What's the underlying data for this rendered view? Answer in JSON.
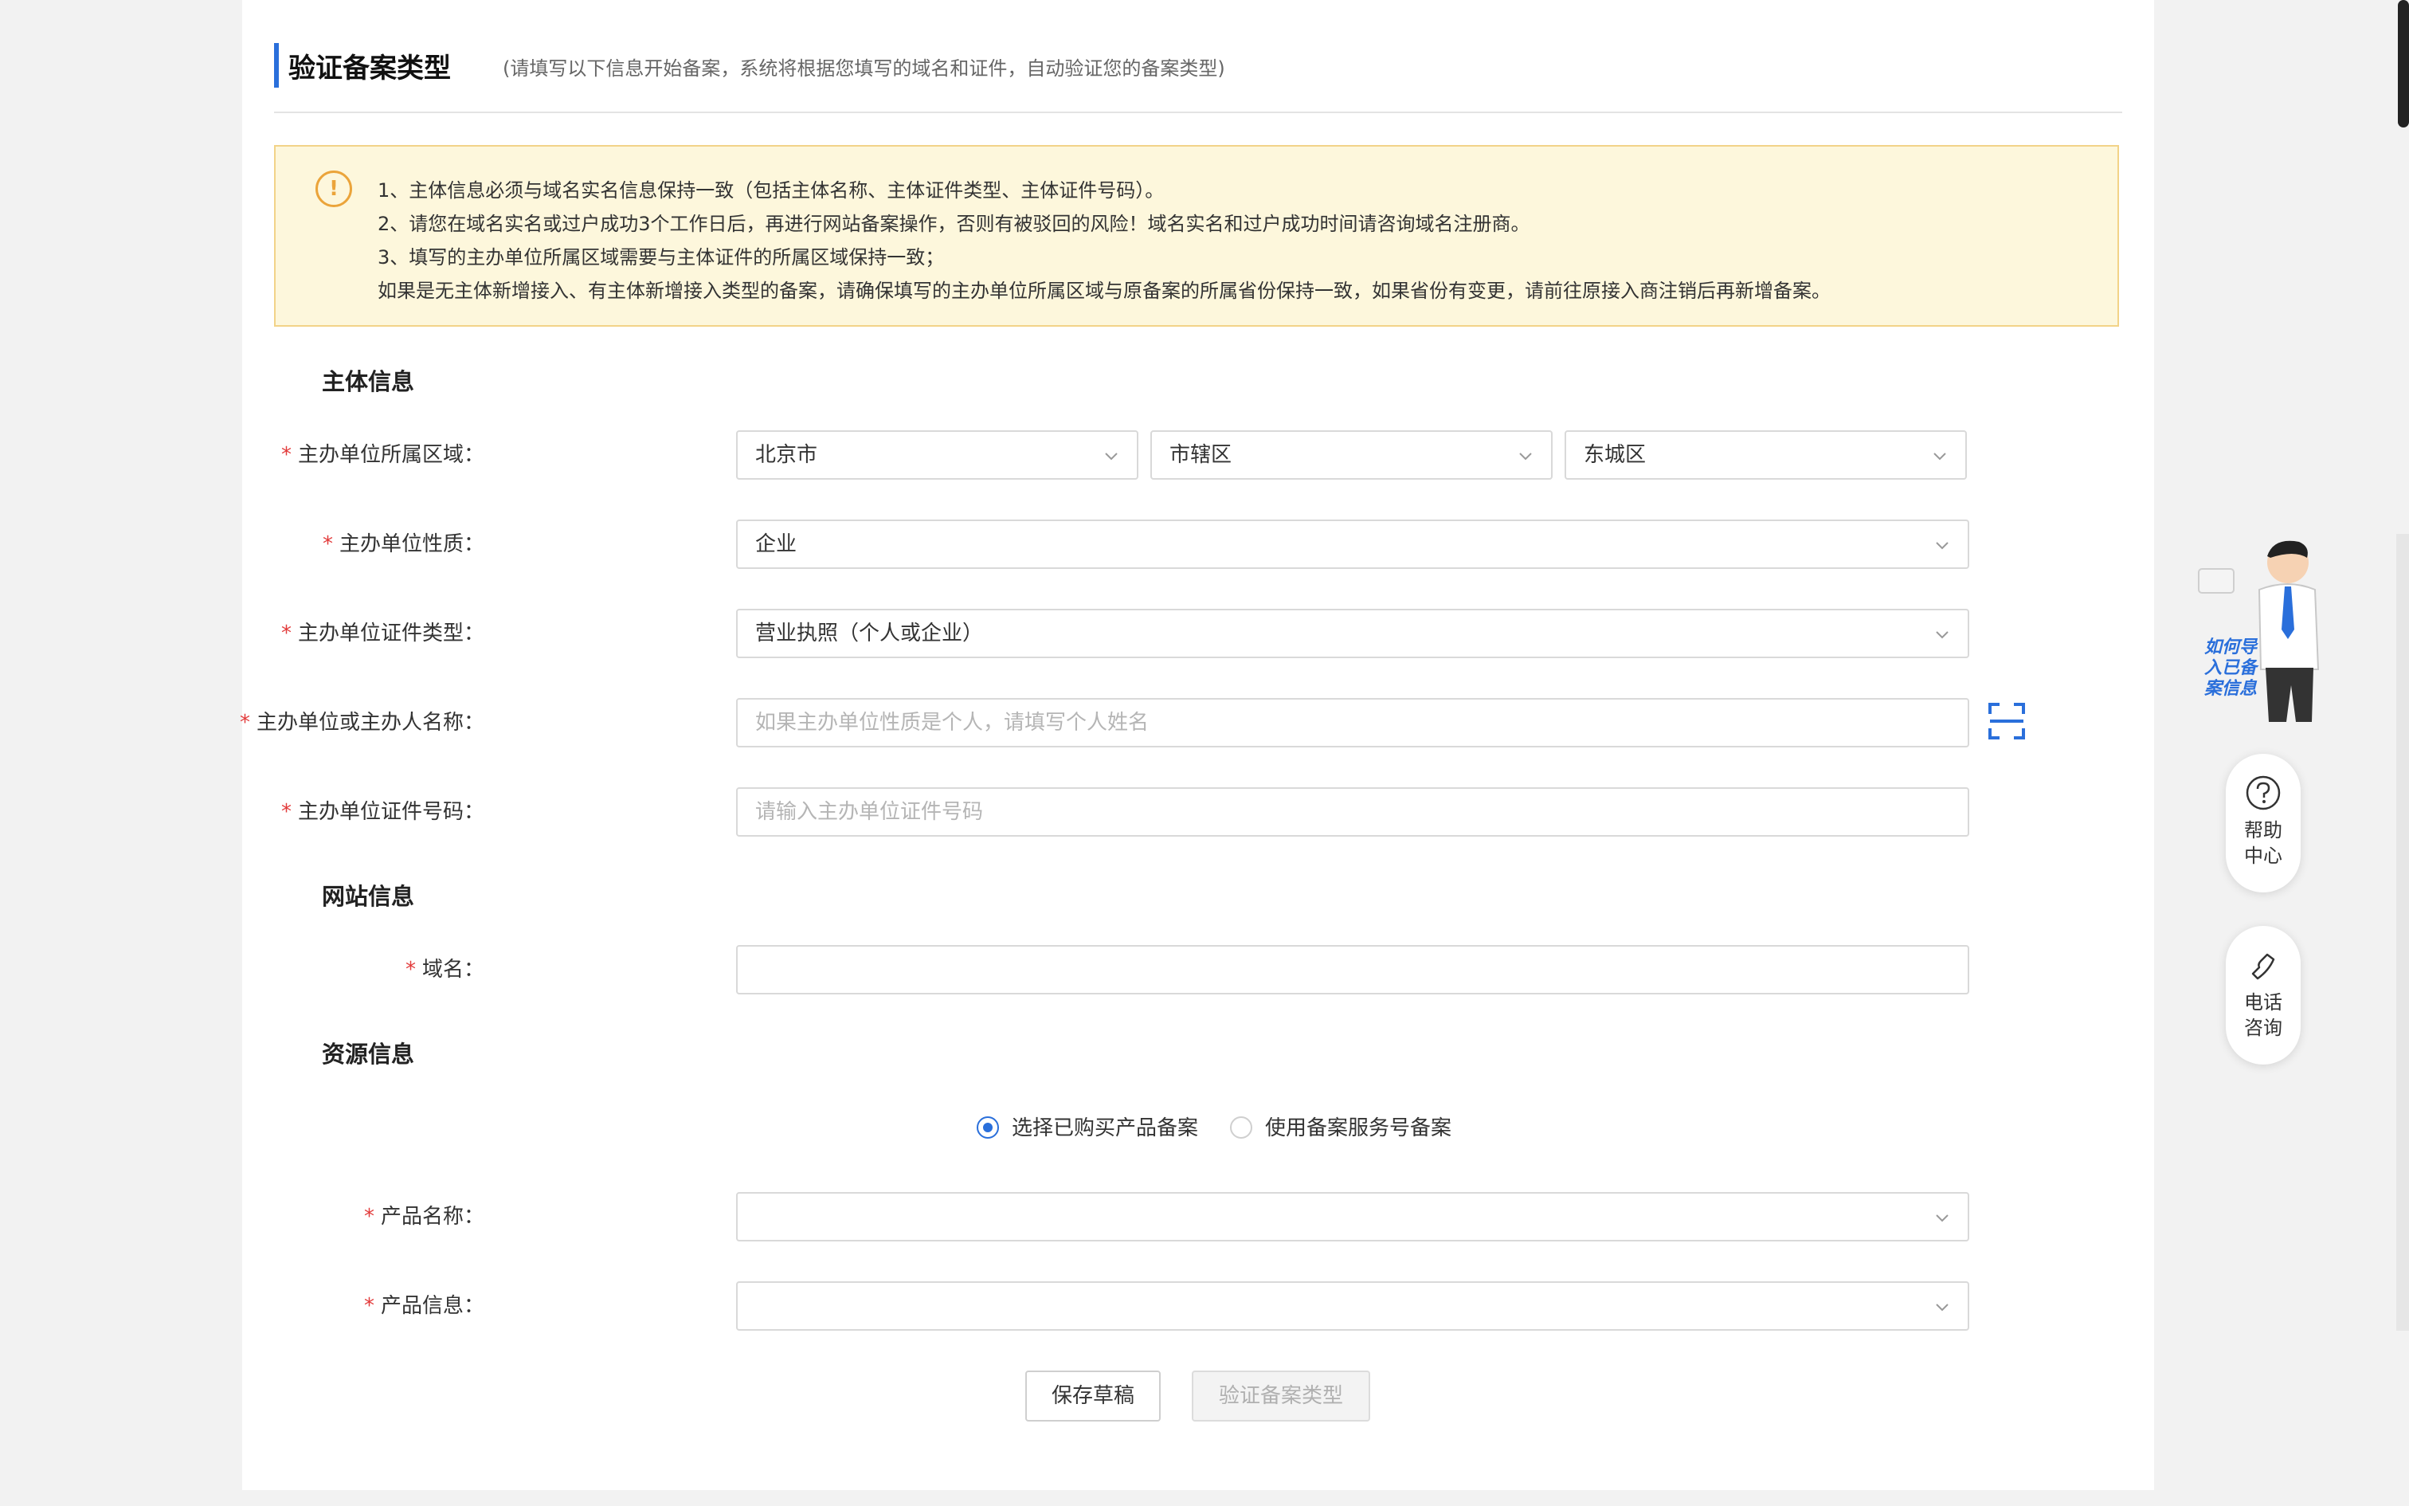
{
  "header": {
    "title": "验证备案类型",
    "subtitle": "(请填写以下信息开始备案，系统将根据您填写的域名和证件，自动验证您的备案类型)"
  },
  "notice": {
    "icon": "warning-icon",
    "lines": [
      "1、主体信息必须与域名实名信息保持一致（包括主体名称、主体证件类型、主体证件号码）。",
      "2、请您在域名实名或过户成功3个工作日后，再进行网站备案操作，否则有被驳回的风险！域名实名和过户成功时间请咨询域名注册商。",
      "3、填写的主办单位所属区域需要与主体证件的所属区域保持一致；",
      "如果是无主体新增接入、有主体新增接入类型的备案，请确保填写的主办单位所属区域与原备案的所属省份保持一致，如果省份有变更，请前往原接入商注销后再新增备案。"
    ]
  },
  "sections": {
    "subject": "主体信息",
    "website": "网站信息",
    "resource": "资源信息"
  },
  "form": {
    "required_mark": "*",
    "region": {
      "label": "主办单位所属区域：",
      "province": "北京市",
      "city": "市辖区",
      "district": "东城区"
    },
    "nature": {
      "label": "主办单位性质：",
      "value": "企业"
    },
    "cert_type": {
      "label": "主办单位证件类型：",
      "value": "营业执照（个人或企业）"
    },
    "name": {
      "label": "主办单位或主办人名称：",
      "placeholder": "如果主办单位性质是个人，请填写个人姓名"
    },
    "cert_no": {
      "label": "主办单位证件号码：",
      "placeholder": "请输入主办单位证件号码"
    },
    "domain": {
      "label": "域名：",
      "value": ""
    },
    "resource_options": {
      "purchased": "选择已购买产品备案",
      "service_no": "使用备案服务号备案",
      "selected": "purchased"
    },
    "product_name": {
      "label": "产品名称：",
      "value": ""
    },
    "product_info": {
      "label": "产品信息：",
      "value": ""
    }
  },
  "buttons": {
    "save_draft": "保存草稿",
    "verify": "验证备案类型"
  },
  "side": {
    "import_text": "如何导入已备案信息",
    "help": "帮助中心",
    "phone": "电话咨询"
  },
  "colors": {
    "accent": "#2a6fdb",
    "required": "#e23b3b",
    "notice_bg": "#fdf7dc",
    "notice_border": "#f2d388",
    "warning": "#eba43a"
  }
}
